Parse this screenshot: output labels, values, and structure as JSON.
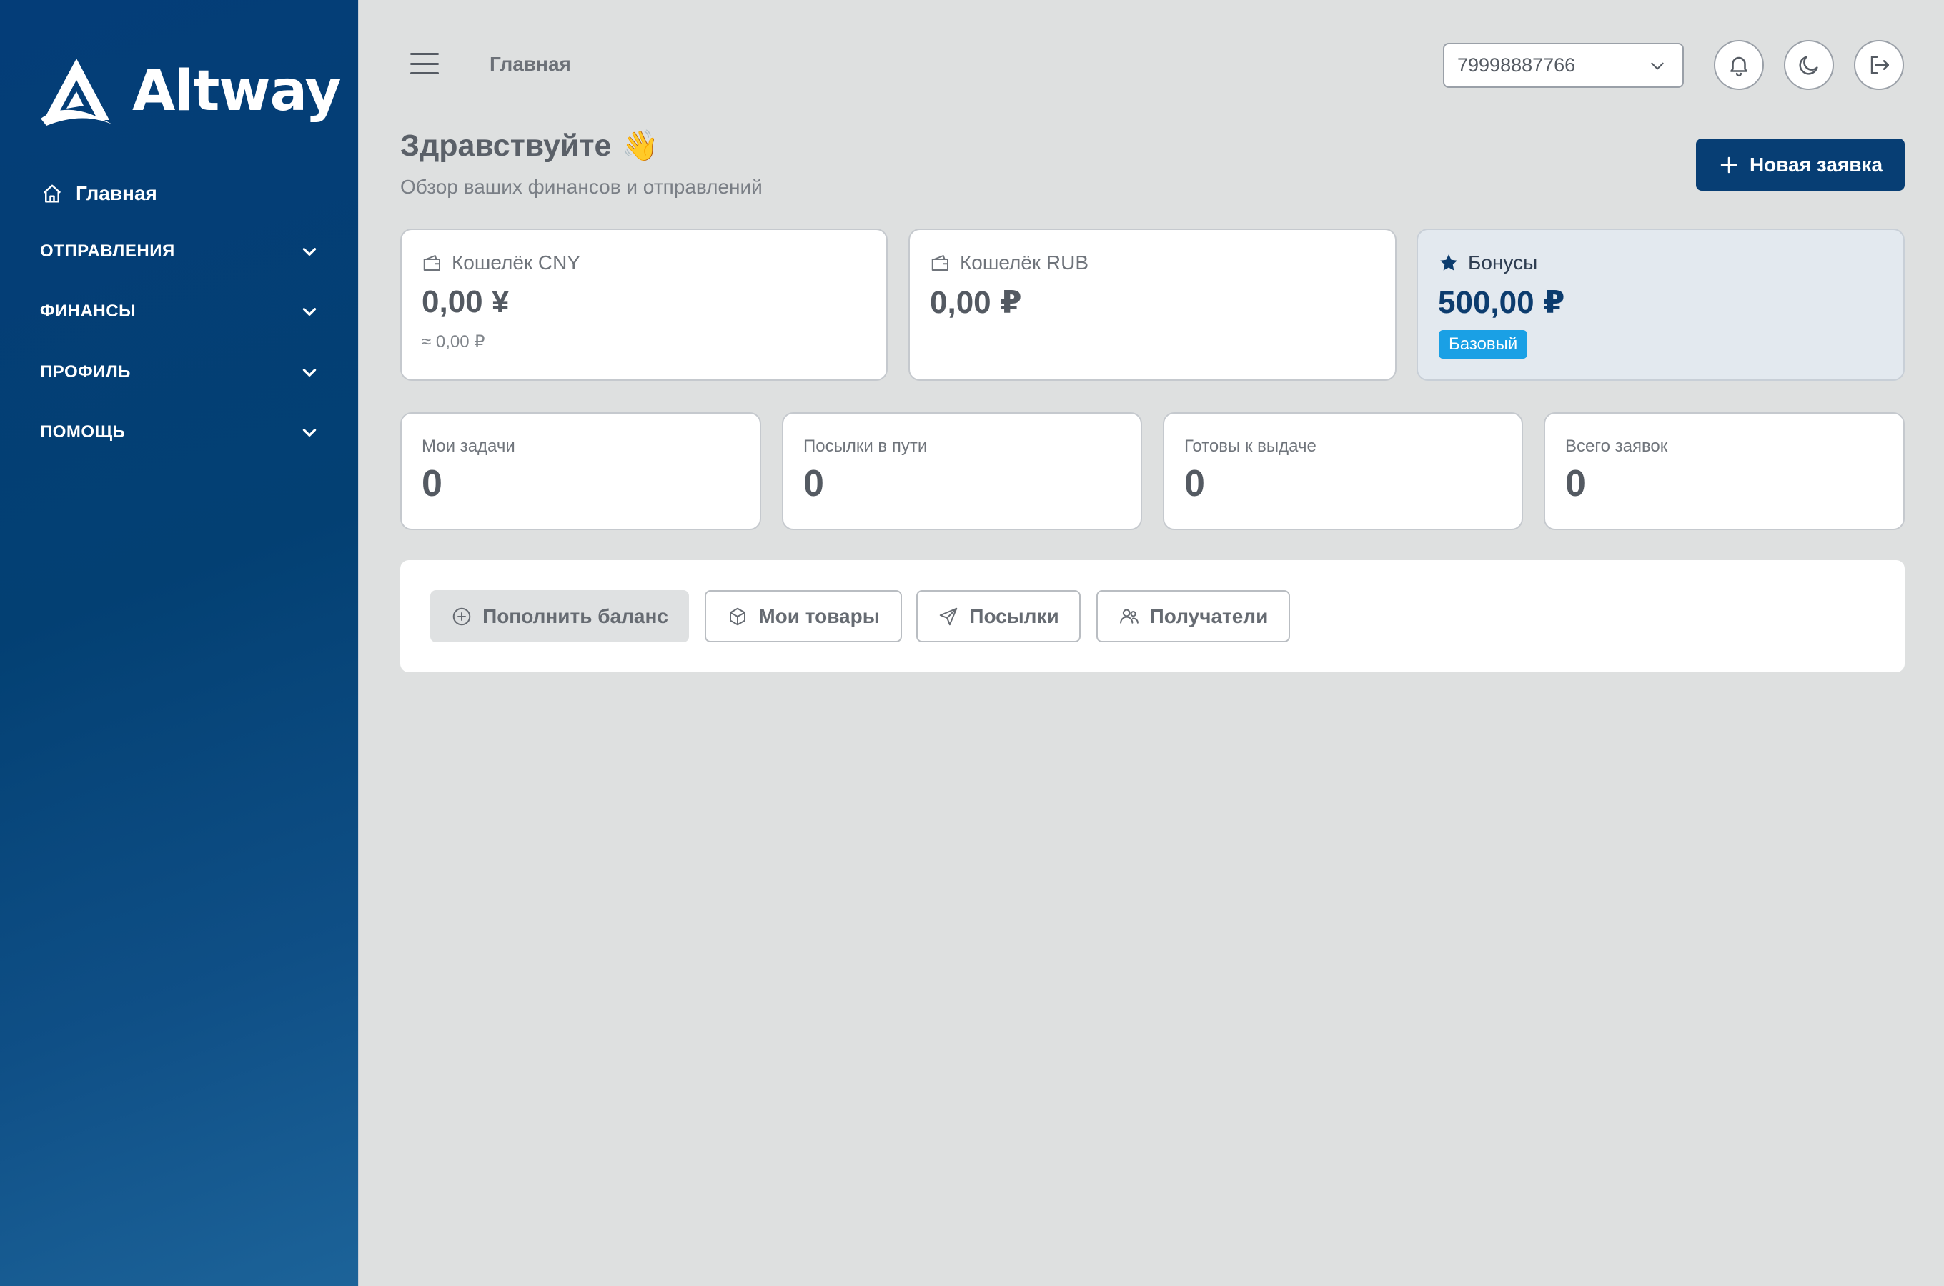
{
  "sidebar": {
    "brand": "Altway",
    "home_label": "Главная",
    "sections": [
      {
        "label": "ОТПРАВЛЕНИЯ"
      },
      {
        "label": "ФИНАНСЫ"
      },
      {
        "label": "ПРОФИЛЬ"
      },
      {
        "label": "ПОМОЩЬ"
      }
    ]
  },
  "header": {
    "breadcrumb": "Главная",
    "account_select": "79998887766"
  },
  "greeting": {
    "title": "Здравствуйте",
    "emoji": "👋",
    "subtitle": "Обзор ваших финансов и отправлений",
    "new_request_label": "Новая заявка"
  },
  "wallets": {
    "cny": {
      "title": "Кошелёк CNY",
      "amount": "0,00 ¥",
      "converted": "≈ 0,00 ₽"
    },
    "rub": {
      "title": "Кошелёк RUB",
      "amount": "0,00 ₽"
    },
    "bonus": {
      "title": "Бонусы",
      "amount": "500,00 ₽",
      "level": "Базовый"
    }
  },
  "stats": [
    {
      "label": "Мои задачи",
      "value": "0"
    },
    {
      "label": "Посылки в пути",
      "value": "0"
    },
    {
      "label": "Готовы к выдаче",
      "value": "0"
    },
    {
      "label": "Всего заявок",
      "value": "0"
    }
  ],
  "actions": {
    "top_up": "Пополнить баланс",
    "my_goods": "Мои товары",
    "parcels": "Посылки",
    "recipients": "Получатели"
  },
  "colors": {
    "sidebar": "#043d78",
    "primary_button": "#073e74",
    "badge": "#1aa0e5",
    "background": "#dee0e0"
  }
}
